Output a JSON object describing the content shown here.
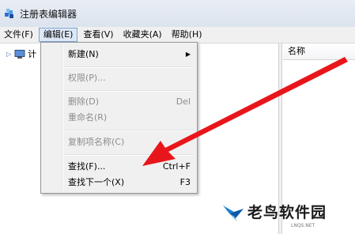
{
  "window": {
    "title": "注册表编辑器",
    "icon": "registry-editor-icon"
  },
  "menubar": {
    "items": [
      {
        "label": "文件(F)"
      },
      {
        "label": "编辑(E)",
        "active": true
      },
      {
        "label": "查看(V)"
      },
      {
        "label": "收藏夹(A)"
      },
      {
        "label": "帮助(H)"
      }
    ]
  },
  "tree": {
    "root_label": "计",
    "root_icon": "computer-icon"
  },
  "list": {
    "column_name": "名称"
  },
  "edit_menu": {
    "new": {
      "label": "新建(N)",
      "submenu": "▶"
    },
    "permissions": {
      "label": "权限(P)..."
    },
    "delete": {
      "label": "删除(D)",
      "shortcut": "Del"
    },
    "rename": {
      "label": "重命名(R)"
    },
    "copy_key_name": {
      "label": "复制项名称(C)"
    },
    "find": {
      "label": "查找(F)...",
      "shortcut": "Ctrl+F"
    },
    "find_next": {
      "label": "查找下一个(X)",
      "shortcut": "F3"
    }
  },
  "annotation": {
    "arrow_color": "#e8161b"
  },
  "watermark": {
    "text": "老鸟软件园",
    "sub": "LNQS.NET"
  }
}
